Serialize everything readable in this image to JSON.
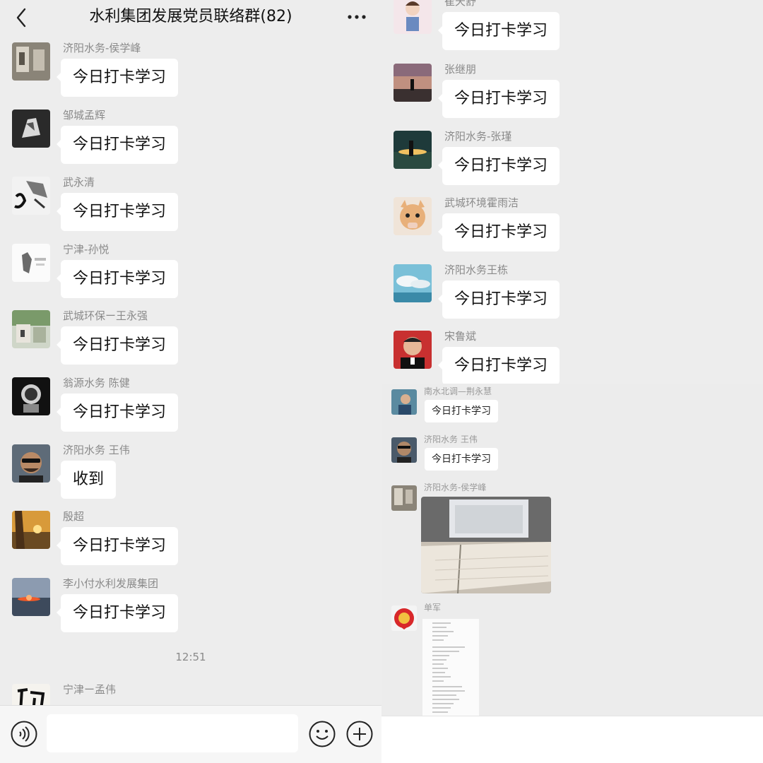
{
  "header": {
    "title": "水利集团发展党员联络群(82)"
  },
  "left_messages": [
    {
      "sender": "济阳水务-侯学峰",
      "text": "今日打卡学习"
    },
    {
      "sender": "邹城孟辉",
      "text": "今日打卡学习"
    },
    {
      "sender": "武永清",
      "text": "今日打卡学习"
    },
    {
      "sender": "宁津-孙悦",
      "text": "今日打卡学习"
    },
    {
      "sender": "武城环保ー王永强",
      "text": "今日打卡学习"
    },
    {
      "sender": "翁源水务 陈健",
      "text": "今日打卡学习"
    },
    {
      "sender": "济阳水务 王伟",
      "text": "收到"
    },
    {
      "sender": "殷超",
      "text": "今日打卡学习"
    },
    {
      "sender": "李小付水利发展集团",
      "text": "今日打卡学习"
    },
    {
      "sender": "宁津ー孟伟",
      "text": ""
    }
  ],
  "timestamp": "12:51",
  "input": {
    "value": "",
    "placeholder": ""
  },
  "right_top_messages": [
    {
      "sender": "崔天舒",
      "text": "今日打卡学习"
    },
    {
      "sender": "张继朋",
      "text": "今日打卡学习"
    },
    {
      "sender": "济阳水务-张瑾",
      "text": "今日打卡学习"
    },
    {
      "sender": "武城环境霍雨洁",
      "text": "今日打卡学习"
    },
    {
      "sender": "济阳水务王栋",
      "text": "今日打卡学习"
    },
    {
      "sender": "宋鲁斌",
      "text": "今日打卡学习"
    }
  ],
  "right_bottom_messages": [
    {
      "sender": "南水北调—荆永慧",
      "text": "今日打卡学习"
    },
    {
      "sender": "济阳水务 王伟",
      "text": "今日打卡学习"
    },
    {
      "sender": "济阳水务-侯学峰",
      "text": ""
    },
    {
      "sender": "单军",
      "text": ""
    }
  ],
  "icons": {
    "back": "chevron-left-icon",
    "more": "more-dots-icon",
    "voice": "voice-icon",
    "emoji": "emoji-icon",
    "plus": "plus-icon"
  }
}
